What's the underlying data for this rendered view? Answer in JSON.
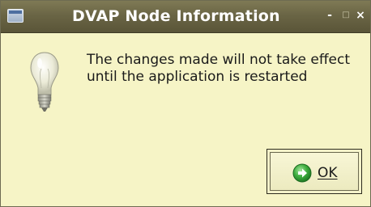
{
  "window": {
    "title": "DVAP Node Information",
    "controls": {
      "minimize": "-",
      "maximize": "□",
      "close": "×"
    }
  },
  "dialog": {
    "icon": "lightbulb-icon",
    "message_line1": "The changes made will not take effect",
    "message_line2": "until the application is restarted"
  },
  "buttons": {
    "ok_label": "OK",
    "ok_icon": "arrow-right-circle-icon"
  },
  "colors": {
    "background": "#f6f4c6",
    "titlebar": "#6a6545",
    "ok_icon_green": "#3fae3f"
  }
}
